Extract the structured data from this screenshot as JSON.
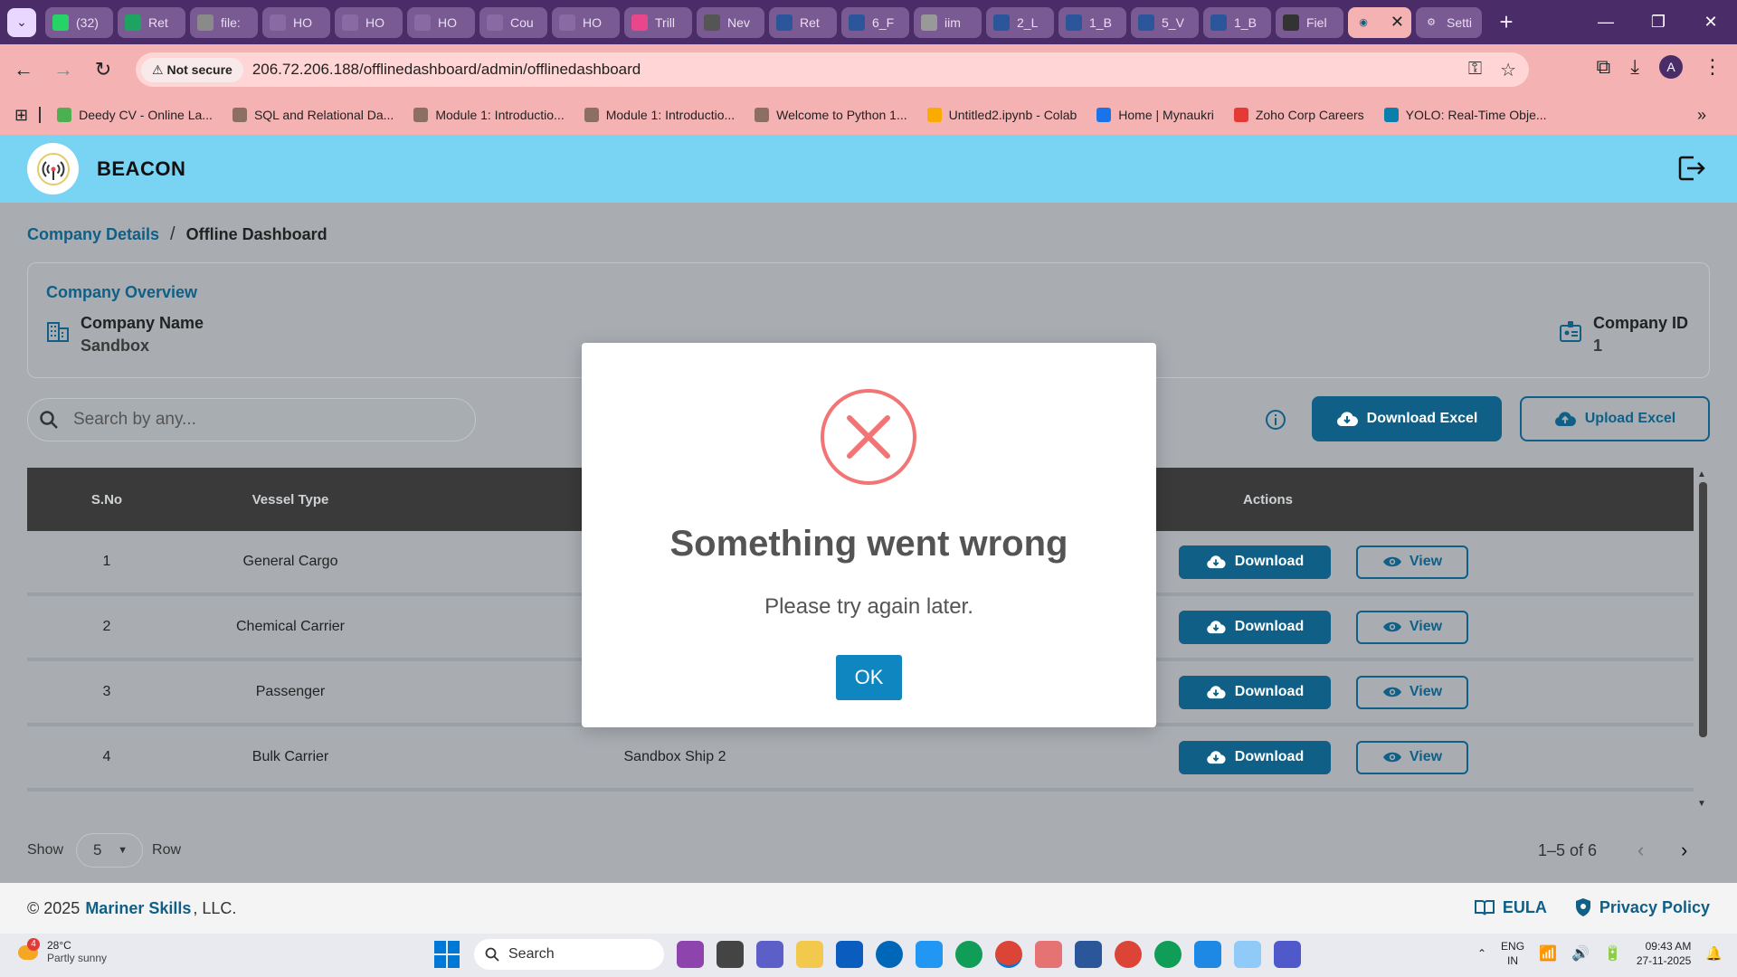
{
  "browser": {
    "tabs": [
      {
        "label": "(32)",
        "color": "#25d366"
      },
      {
        "label": "Ret",
        "color": "#1ea362"
      },
      {
        "label": "file:",
        "color": "#8a8a8a"
      },
      {
        "label": "HO",
        "color": "#8a6aa3"
      },
      {
        "label": "HO",
        "color": "#8a6aa3"
      },
      {
        "label": "HO",
        "color": "#8a6aa3"
      },
      {
        "label": "Cou",
        "color": "#8a6aa3"
      },
      {
        "label": "HO",
        "color": "#8a6aa3"
      },
      {
        "label": "Trill",
        "color": "#e8478b"
      },
      {
        "label": "Nev",
        "color": "#555555"
      },
      {
        "label": "Ret",
        "color": "#2b579a"
      },
      {
        "label": "6_F",
        "color": "#2b579a"
      },
      {
        "label": "iim",
        "color": "#999999"
      },
      {
        "label": "2_L",
        "color": "#2b579a"
      },
      {
        "label": "1_B",
        "color": "#2b579a"
      },
      {
        "label": "5_V",
        "color": "#2b579a"
      },
      {
        "label": "1_B",
        "color": "#2b579a"
      },
      {
        "label": "Fiel",
        "color": "#333333"
      }
    ],
    "active_tab_close": "✕",
    "last_tab": "Setti",
    "new_tab": "+",
    "not_secure": "Not secure",
    "url": "206.72.206.188/offlinedashboard/admin/offlinedashboard",
    "profile_initial": "A",
    "bookmarks": [
      {
        "label": "Deedy CV - Online La...",
        "color": "#4caf50"
      },
      {
        "label": "SQL and Relational Da...",
        "color": "#8d6e63"
      },
      {
        "label": "Module 1: Introductio...",
        "color": "#8d6e63"
      },
      {
        "label": "Module 1: Introductio...",
        "color": "#8d6e63"
      },
      {
        "label": "Welcome to Python 1...",
        "color": "#8d6e63"
      },
      {
        "label": "Untitled2.ipynb - Colab",
        "color": "#f9ab00"
      },
      {
        "label": "Home | Mynaukri",
        "color": "#1a73e8"
      },
      {
        "label": "Zoho Corp Careers",
        "color": "#e53935"
      },
      {
        "label": "YOLO: Real-Time Obje...",
        "color": "#0b7fab"
      }
    ]
  },
  "app": {
    "brand": "BEACON",
    "breadcrumb": {
      "parent": "Company Details",
      "separator": "/",
      "current": "Offline Dashboard"
    },
    "overview": {
      "title": "Company Overview",
      "name_label": "Company Name",
      "name_value": "Sandbox",
      "id_label": "Company ID",
      "id_value": "1"
    },
    "search_placeholder": "Search by any...",
    "download_excel": "Download Excel",
    "upload_excel": "Upload Excel",
    "table": {
      "headers": {
        "sno": "S.No",
        "type": "Vessel Type",
        "actions": "Actions"
      },
      "rows": [
        {
          "sno": "1",
          "type": "General Cargo",
          "name": ""
        },
        {
          "sno": "2",
          "type": "Chemical Carrier",
          "name": ""
        },
        {
          "sno": "3",
          "type": "Passenger",
          "name": ""
        },
        {
          "sno": "4",
          "type": "Bulk Carrier",
          "name": "Sandbox Ship 2"
        }
      ],
      "download_label": "Download",
      "view_label": "View"
    },
    "pager": {
      "show": "Show",
      "rows_value": "5",
      "row": "Row",
      "info": "1–5 of 6"
    },
    "footer": {
      "copyright": "© 2025",
      "company": "Mariner Skills",
      "suffix": ", LLC.",
      "eula": "EULA",
      "privacy": "Privacy Policy"
    },
    "colors": {
      "primary": "#0f5f86",
      "header": "#79d3f3",
      "error": "#f27474"
    }
  },
  "modal": {
    "title": "Something went wrong",
    "text": "Please try again later.",
    "ok": "OK"
  },
  "taskbar": {
    "weather_badge": "4",
    "temp": "28°C",
    "weather": "Partly sunny",
    "search": "Search",
    "lang_1": "ENG",
    "lang_2": "IN",
    "time": "09:43 AM",
    "date": "27-11-2025"
  }
}
